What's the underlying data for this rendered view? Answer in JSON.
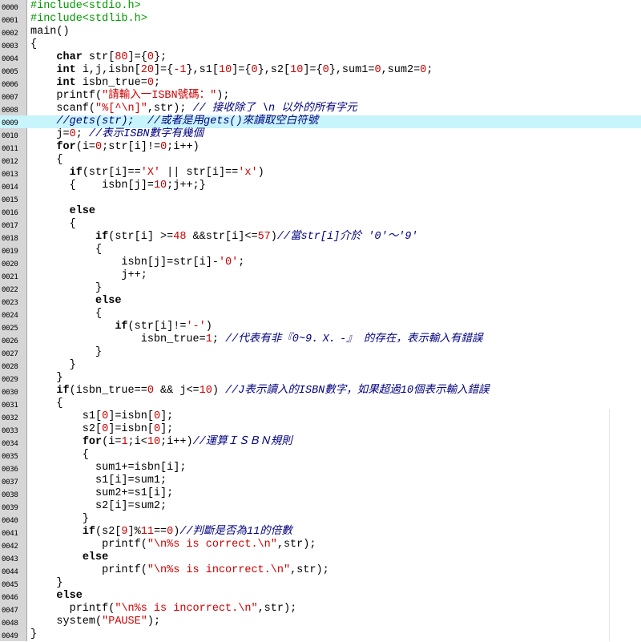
{
  "highlight_line": 9,
  "colors": {
    "preprocessor": "#009900",
    "keyword": "#000000",
    "number": "#cc0000",
    "string": "#cc0000",
    "comment": "#000080",
    "highlight": "#c8f4fb",
    "gutter": "#d6d6d6"
  },
  "lines": [
    {
      "num": "0000",
      "tokens": [
        [
          "pp",
          "#include<stdio.h>"
        ]
      ]
    },
    {
      "num": "0001",
      "tokens": [
        [
          "pp",
          "#include<stdlib.h>"
        ]
      ]
    },
    {
      "num": "0002",
      "tokens": [
        [
          "plain",
          "main()"
        ]
      ]
    },
    {
      "num": "0003",
      "tokens": [
        [
          "plain",
          "{"
        ]
      ]
    },
    {
      "num": "0004",
      "tokens": [
        [
          "plain",
          "    "
        ],
        [
          "kw",
          "char"
        ],
        [
          "plain",
          " str["
        ],
        [
          "num",
          "80"
        ],
        [
          "plain",
          "]={"
        ],
        [
          "num",
          "0"
        ],
        [
          "plain",
          "};"
        ]
      ]
    },
    {
      "num": "0005",
      "tokens": [
        [
          "plain",
          "    "
        ],
        [
          "kw",
          "int"
        ],
        [
          "plain",
          " i,j,isbn["
        ],
        [
          "num",
          "20"
        ],
        [
          "plain",
          "]={"
        ],
        [
          "num",
          "-1"
        ],
        [
          "plain",
          "},s1["
        ],
        [
          "num",
          "10"
        ],
        [
          "plain",
          "]={"
        ],
        [
          "num",
          "0"
        ],
        [
          "plain",
          "},s2["
        ],
        [
          "num",
          "10"
        ],
        [
          "plain",
          "]={"
        ],
        [
          "num",
          "0"
        ],
        [
          "plain",
          "},sum1="
        ],
        [
          "num",
          "0"
        ],
        [
          "plain",
          ",sum2="
        ],
        [
          "num",
          "0"
        ],
        [
          "plain",
          ";"
        ]
      ]
    },
    {
      "num": "0006",
      "tokens": [
        [
          "plain",
          "    "
        ],
        [
          "kw",
          "int"
        ],
        [
          "plain",
          " isbn_true="
        ],
        [
          "num",
          "0"
        ],
        [
          "plain",
          ";"
        ]
      ]
    },
    {
      "num": "0007",
      "tokens": [
        [
          "plain",
          "    printf("
        ],
        [
          "str",
          "\"請輸入一ISBN號碼：\""
        ],
        [
          "plain",
          ");"
        ]
      ]
    },
    {
      "num": "0008",
      "tokens": [
        [
          "plain",
          "    scanf("
        ],
        [
          "str",
          "\"%[^\\n]\""
        ],
        [
          "plain",
          ",str); "
        ],
        [
          "cmt",
          "// 接收除了 \\n 以外的所有字元"
        ]
      ]
    },
    {
      "num": "0009",
      "tokens": [
        [
          "plain",
          "    "
        ],
        [
          "cmt",
          "//gets(str);  //或者是用gets()來讀取空白符號"
        ]
      ]
    },
    {
      "num": "0010",
      "tokens": [
        [
          "plain",
          "    j="
        ],
        [
          "num",
          "0"
        ],
        [
          "plain",
          "; "
        ],
        [
          "cmt",
          "//表示ISBN數字有幾個"
        ]
      ]
    },
    {
      "num": "0011",
      "tokens": [
        [
          "plain",
          "    "
        ],
        [
          "kw",
          "for"
        ],
        [
          "plain",
          "(i="
        ],
        [
          "num",
          "0"
        ],
        [
          "plain",
          ";str[i]!="
        ],
        [
          "num",
          "0"
        ],
        [
          "plain",
          ";i++)"
        ]
      ]
    },
    {
      "num": "0012",
      "tokens": [
        [
          "plain",
          "    {"
        ]
      ]
    },
    {
      "num": "0013",
      "tokens": [
        [
          "plain",
          "      "
        ],
        [
          "kw",
          "if"
        ],
        [
          "plain",
          "(str[i]=="
        ],
        [
          "str",
          "'X'"
        ],
        [
          "plain",
          " || str[i]=="
        ],
        [
          "str",
          "'x'"
        ],
        [
          "plain",
          ")"
        ]
      ]
    },
    {
      "num": "0014",
      "tokens": [
        [
          "plain",
          "      {    isbn[j]="
        ],
        [
          "num",
          "10"
        ],
        [
          "plain",
          ";j++;}"
        ]
      ]
    },
    {
      "num": "0015",
      "tokens": []
    },
    {
      "num": "0016",
      "tokens": [
        [
          "plain",
          "      "
        ],
        [
          "kw",
          "else"
        ]
      ]
    },
    {
      "num": "0017",
      "tokens": [
        [
          "plain",
          "      {"
        ]
      ]
    },
    {
      "num": "0018",
      "tokens": [
        [
          "plain",
          "          "
        ],
        [
          "kw",
          "if"
        ],
        [
          "plain",
          "(str[i] >="
        ],
        [
          "num",
          "48"
        ],
        [
          "plain",
          " &&str[i]<="
        ],
        [
          "num",
          "57"
        ],
        [
          "plain",
          ")"
        ],
        [
          "cmt",
          "//當str[i]介於 '0'～'9'"
        ]
      ]
    },
    {
      "num": "0019",
      "tokens": [
        [
          "plain",
          "          {"
        ]
      ]
    },
    {
      "num": "0020",
      "tokens": [
        [
          "plain",
          "              isbn[j]=str[i]-"
        ],
        [
          "str",
          "'0'"
        ],
        [
          "plain",
          ";"
        ]
      ]
    },
    {
      "num": "0021",
      "tokens": [
        [
          "plain",
          "              j++;"
        ]
      ]
    },
    {
      "num": "0022",
      "tokens": [
        [
          "plain",
          "          }"
        ]
      ]
    },
    {
      "num": "0023",
      "tokens": [
        [
          "plain",
          "          "
        ],
        [
          "kw",
          "else"
        ]
      ]
    },
    {
      "num": "0024",
      "tokens": [
        [
          "plain",
          "          {"
        ]
      ]
    },
    {
      "num": "0025",
      "tokens": [
        [
          "plain",
          "             "
        ],
        [
          "kw",
          "if"
        ],
        [
          "plain",
          "(str[i]!="
        ],
        [
          "str",
          "'-'"
        ],
        [
          "plain",
          ")"
        ]
      ]
    },
    {
      "num": "0026",
      "tokens": [
        [
          "plain",
          "                 isbn_true="
        ],
        [
          "num",
          "1"
        ],
        [
          "plain",
          "; "
        ],
        [
          "cmt",
          "//代表有非『0~9．X．-』 的存在，表示輸入有錯誤"
        ]
      ]
    },
    {
      "num": "0027",
      "tokens": [
        [
          "plain",
          "          }"
        ]
      ]
    },
    {
      "num": "0028",
      "tokens": [
        [
          "plain",
          "      }"
        ]
      ]
    },
    {
      "num": "0029",
      "tokens": [
        [
          "plain",
          "    }"
        ]
      ]
    },
    {
      "num": "0030",
      "tokens": [
        [
          "plain",
          "    "
        ],
        [
          "kw",
          "if"
        ],
        [
          "plain",
          "(isbn_true=="
        ],
        [
          "num",
          "0"
        ],
        [
          "plain",
          " && j<="
        ],
        [
          "num",
          "10"
        ],
        [
          "plain",
          ") "
        ],
        [
          "cmt",
          "//J表示讀入的ISBN數字，如果超過10個表示輸入錯誤"
        ]
      ]
    },
    {
      "num": "0031",
      "tokens": [
        [
          "plain",
          "    {"
        ]
      ]
    },
    {
      "num": "0032",
      "tokens": [
        [
          "plain",
          "        s1["
        ],
        [
          "num",
          "0"
        ],
        [
          "plain",
          "]=isbn["
        ],
        [
          "num",
          "0"
        ],
        [
          "plain",
          "];"
        ]
      ]
    },
    {
      "num": "0033",
      "tokens": [
        [
          "plain",
          "        s2["
        ],
        [
          "num",
          "0"
        ],
        [
          "plain",
          "]=isbn["
        ],
        [
          "num",
          "0"
        ],
        [
          "plain",
          "];"
        ]
      ]
    },
    {
      "num": "0034",
      "tokens": [
        [
          "plain",
          "        "
        ],
        [
          "kw",
          "for"
        ],
        [
          "plain",
          "(i="
        ],
        [
          "num",
          "1"
        ],
        [
          "plain",
          ";i<"
        ],
        [
          "num",
          "10"
        ],
        [
          "plain",
          ";i++)"
        ],
        [
          "cmt",
          "//運算ＩＳＢＮ規則"
        ]
      ]
    },
    {
      "num": "0035",
      "tokens": [
        [
          "plain",
          "        {"
        ]
      ]
    },
    {
      "num": "0036",
      "tokens": [
        [
          "plain",
          "          sum1+=isbn[i];"
        ]
      ]
    },
    {
      "num": "0037",
      "tokens": [
        [
          "plain",
          "          s1[i]=sum1;"
        ]
      ]
    },
    {
      "num": "0038",
      "tokens": [
        [
          "plain",
          "          sum2+=s1[i];"
        ]
      ]
    },
    {
      "num": "0039",
      "tokens": [
        [
          "plain",
          "          s2[i]=sum2;"
        ]
      ]
    },
    {
      "num": "0040",
      "tokens": [
        [
          "plain",
          "        }"
        ]
      ]
    },
    {
      "num": "0041",
      "tokens": [
        [
          "plain",
          "        "
        ],
        [
          "kw",
          "if"
        ],
        [
          "plain",
          "(s2["
        ],
        [
          "num",
          "9"
        ],
        [
          "plain",
          "]%"
        ],
        [
          "num",
          "11"
        ],
        [
          "plain",
          "=="
        ],
        [
          "num",
          "0"
        ],
        [
          "plain",
          ")"
        ],
        [
          "cmt",
          "//判斷是否為11的倍數"
        ]
      ]
    },
    {
      "num": "0042",
      "tokens": [
        [
          "plain",
          "           printf("
        ],
        [
          "str",
          "\"\\n%s is correct.\\n\""
        ],
        [
          "plain",
          ",str);"
        ]
      ]
    },
    {
      "num": "0043",
      "tokens": [
        [
          "plain",
          "        "
        ],
        [
          "kw",
          "else"
        ]
      ]
    },
    {
      "num": "0044",
      "tokens": [
        [
          "plain",
          "           printf("
        ],
        [
          "str",
          "\"\\n%s is incorrect.\\n\""
        ],
        [
          "plain",
          ",str);"
        ]
      ]
    },
    {
      "num": "0045",
      "tokens": [
        [
          "plain",
          "    }"
        ]
      ]
    },
    {
      "num": "0046",
      "tokens": [
        [
          "plain",
          "    "
        ],
        [
          "kw",
          "else"
        ]
      ]
    },
    {
      "num": "0047",
      "tokens": [
        [
          "plain",
          "      printf("
        ],
        [
          "str",
          "\"\\n%s is incorrect.\\n\""
        ],
        [
          "plain",
          ",str);"
        ]
      ]
    },
    {
      "num": "0048",
      "tokens": [
        [
          "plain",
          "    system("
        ],
        [
          "str",
          "\"PAUSE\""
        ],
        [
          "plain",
          ");"
        ]
      ]
    },
    {
      "num": "0049",
      "tokens": [
        [
          "plain",
          "}"
        ]
      ]
    }
  ]
}
